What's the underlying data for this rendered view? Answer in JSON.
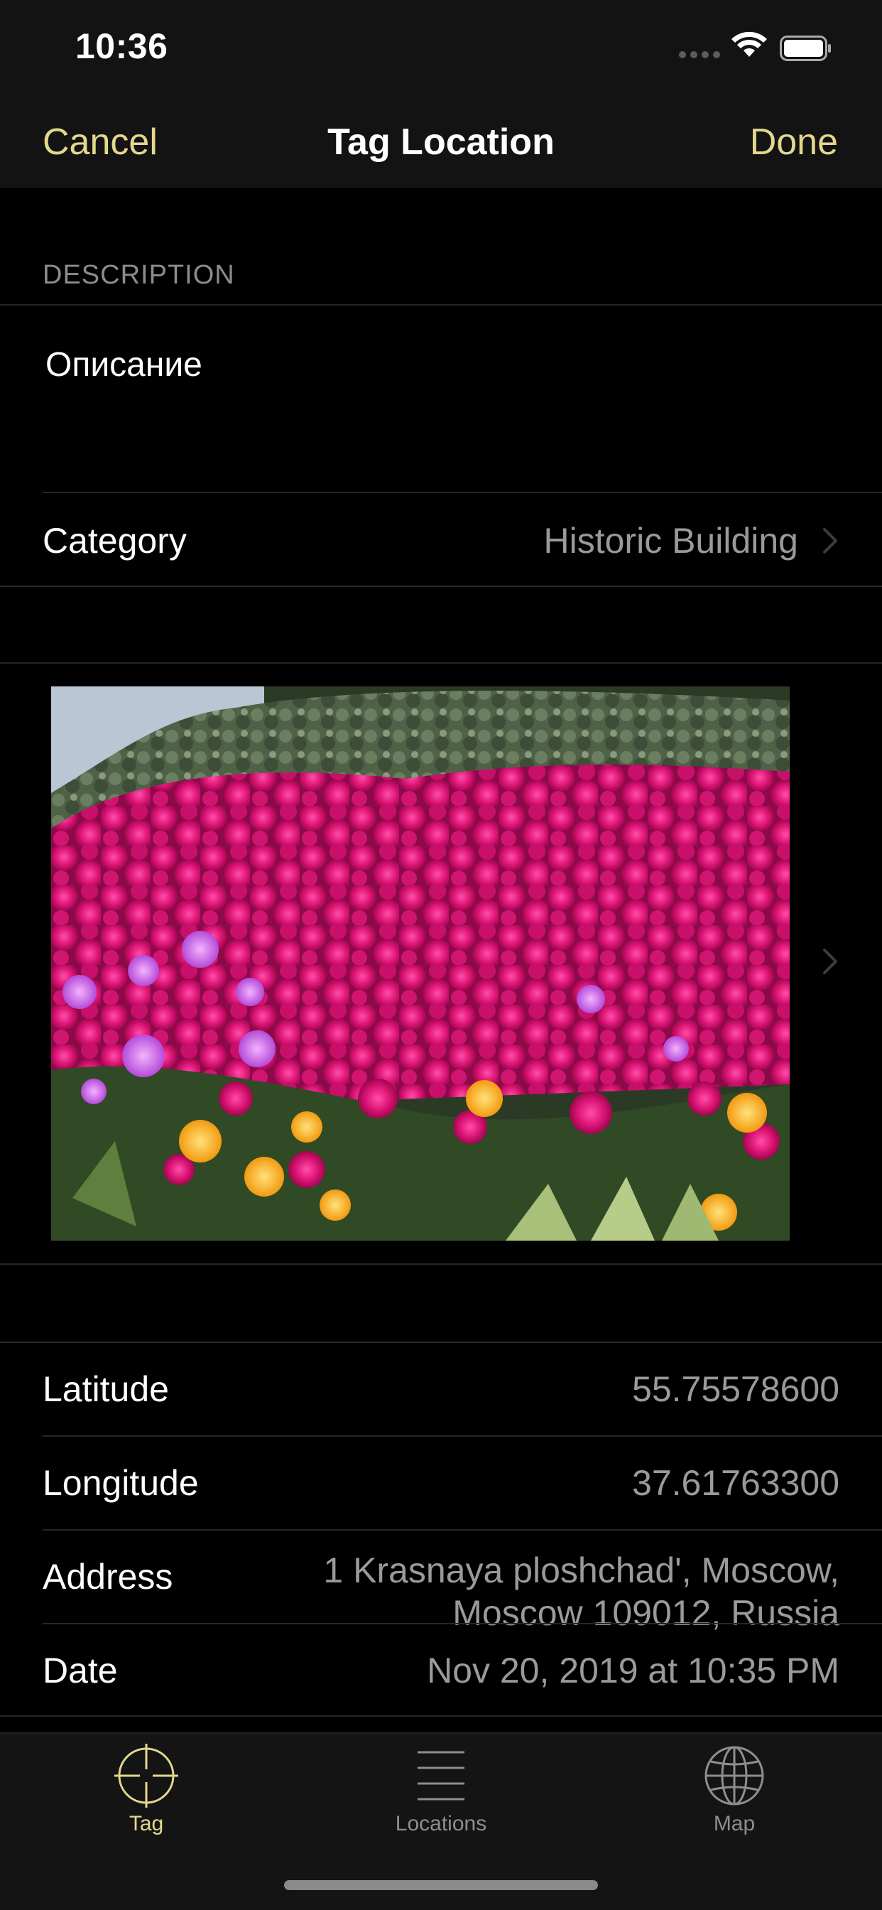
{
  "status_bar": {
    "time": "10:36",
    "signal_icon": "cellular-signal-icon",
    "wifi_icon": "wifi-icon",
    "battery_icon": "battery-icon"
  },
  "nav": {
    "cancel_label": "Cancel",
    "title": "Tag Location",
    "done_label": "Done",
    "accent_color": "#e3d78d"
  },
  "description": {
    "header": "DESCRIPTION",
    "value": "Описание"
  },
  "category": {
    "label": "Category",
    "value": "Historic Building"
  },
  "photo": {
    "chevron_icon": "chevron-right-icon"
  },
  "details": {
    "latitude_label": "Latitude",
    "latitude_value": "55.75578600",
    "longitude_label": "Longitude",
    "longitude_value": "37.61763300",
    "address_label": "Address",
    "address_line1": "1 Krasnaya ploshchad', Moscow,",
    "address_line2": "Moscow 109012, Russia",
    "date_label": "Date",
    "date_value": "Nov 20, 2019 at 10:35 PM"
  },
  "tabs": [
    {
      "label": "Tag",
      "icon": "crosshair-icon",
      "selected": true
    },
    {
      "label": "Locations",
      "icon": "list-icon",
      "selected": false
    },
    {
      "label": "Map",
      "icon": "globe-icon",
      "selected": false
    }
  ],
  "colors": {
    "selected_tab": "#e3d78d",
    "unselected_tab": "#8e8e8e"
  }
}
